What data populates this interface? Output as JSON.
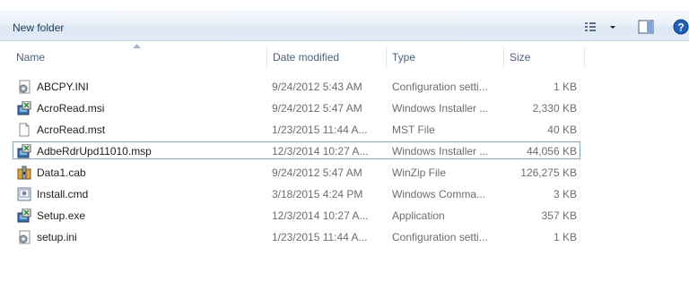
{
  "toolbar": {
    "new_folder_label": "New folder",
    "icons": [
      "views-icon",
      "chevron-down-icon",
      "preview-pane-icon",
      "help-icon"
    ]
  },
  "columns": {
    "name": "Name",
    "date": "Date modified",
    "type": "Type",
    "size": "Size"
  },
  "files": [
    {
      "name": "ABCPY.INI",
      "date": "9/24/2012 5:43 AM",
      "type": "Configuration setti...",
      "size": "1 KB",
      "icon": "config-file-icon"
    },
    {
      "name": "AcroRead.msi",
      "date": "9/24/2012 5:47 AM",
      "type": "Windows Installer ...",
      "size": "2,330 KB",
      "icon": "installer-icon"
    },
    {
      "name": "AcroRead.mst",
      "date": "1/23/2015 11:44 A...",
      "type": "MST File",
      "size": "40 KB",
      "icon": "blank-file-icon"
    },
    {
      "name": "AdbeRdrUpd11010.msp",
      "date": "12/3/2014 10:27 A...",
      "type": "Windows Installer ...",
      "size": "44,056 KB",
      "icon": "installer-icon",
      "selected": true
    },
    {
      "name": "Data1.cab",
      "date": "9/24/2012 5:47 AM",
      "type": "WinZip File",
      "size": "126,275 KB",
      "icon": "winzip-icon"
    },
    {
      "name": "Install.cmd",
      "date": "3/18/2015 4:24 PM",
      "type": "Windows Comma...",
      "size": "3 KB",
      "icon": "command-file-icon"
    },
    {
      "name": "Setup.exe",
      "date": "12/3/2014 10:27 A...",
      "type": "Application",
      "size": "357 KB",
      "icon": "installer-icon"
    },
    {
      "name": "setup.ini",
      "date": "1/23/2015 11:44 A...",
      "type": "Configuration setti...",
      "size": "1 KB",
      "icon": "config-file-icon"
    }
  ],
  "colors": {
    "toolbar_text": "#1e395b",
    "header_text": "#4c607a",
    "secondary_text": "#6d6d6d",
    "selection_border": "#8fa3b6"
  }
}
